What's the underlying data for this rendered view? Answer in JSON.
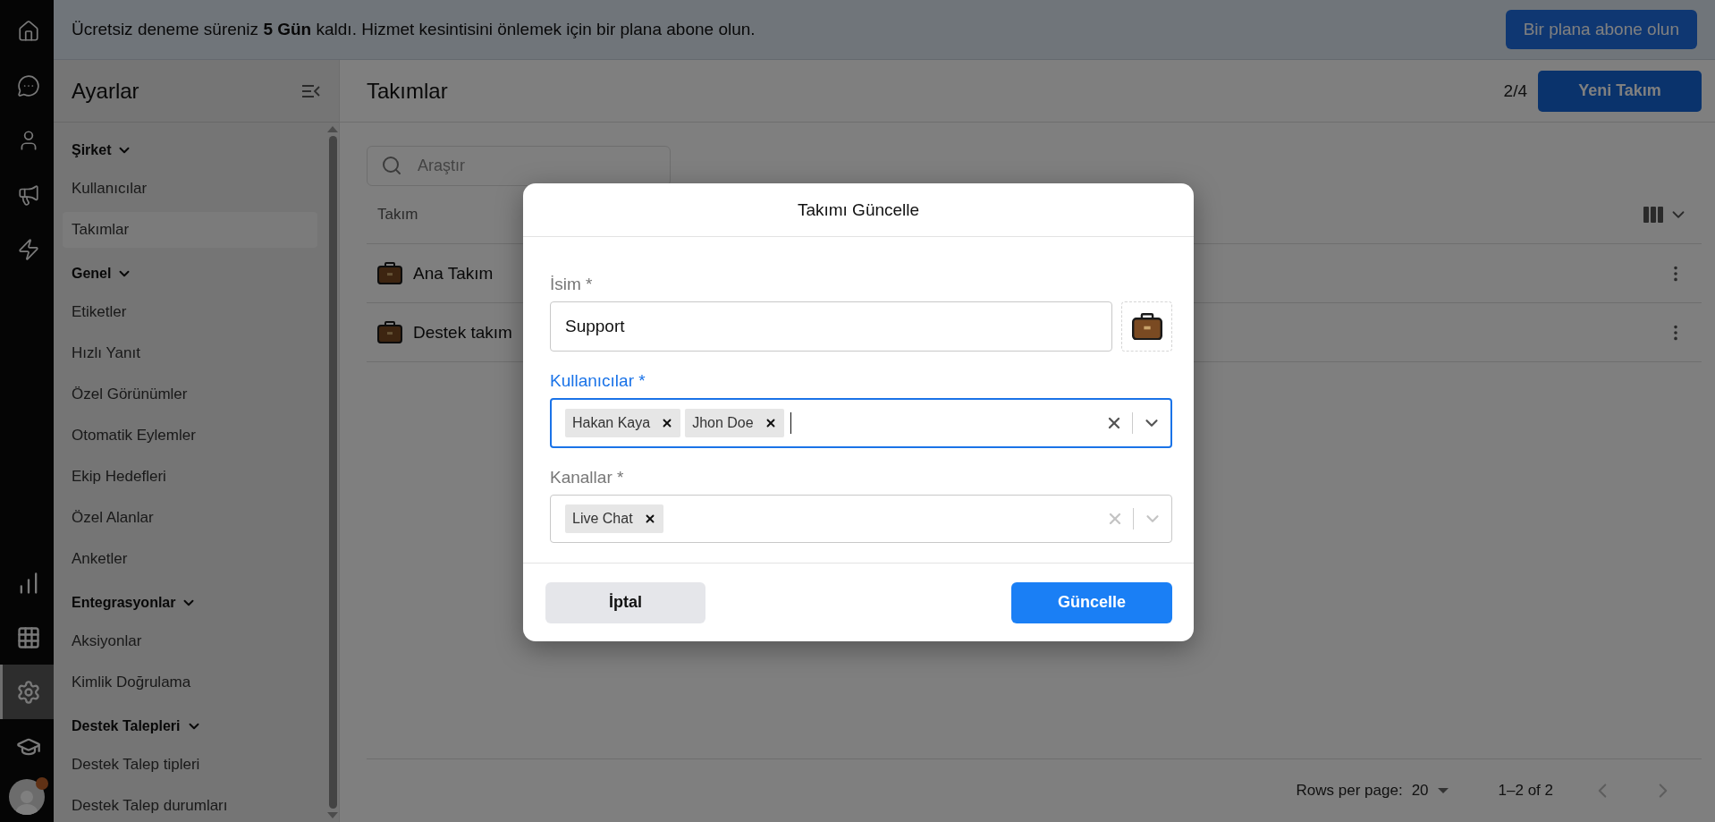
{
  "rail": {
    "top_items": [
      {
        "selected": false
      },
      {
        "selected": false
      },
      {
        "selected": false
      },
      {
        "selected": false
      },
      {
        "selected": false
      }
    ],
    "bottom_items": [
      {
        "selected": false
      },
      {
        "selected": false
      },
      {
        "selected": true
      },
      {
        "selected": false
      }
    ],
    "avatar": {
      "notification": true
    }
  },
  "banner": {
    "text": "Ücretsiz deneme süreniz **5 Gün** kaldı. Hizmet kesintisini önlemek için bir plana abone olun.",
    "button": "Bir plana abone olun"
  },
  "sidebar": {
    "title": "Ayarlar",
    "sections": [
      {
        "title": "Şirket",
        "expanded": true,
        "items": [
          {
            "label": "Kullanıcılar",
            "selected": false
          },
          {
            "label": "Takımlar",
            "selected": true
          }
        ]
      },
      {
        "title": "Genel",
        "expanded": true,
        "items": [
          {
            "label": "Etiketler",
            "selected": false
          },
          {
            "label": "Hızlı Yanıt",
            "selected": false
          },
          {
            "label": "Özel Görünümler",
            "selected": false
          },
          {
            "label": "Otomatik Eylemler",
            "selected": false
          },
          {
            "label": "Ekip Hedefleri",
            "selected": false
          },
          {
            "label": "Özel Alanlar",
            "selected": false
          },
          {
            "label": "Anketler",
            "selected": false
          }
        ]
      },
      {
        "title": "Entegrasyonlar",
        "expanded": true,
        "items": [
          {
            "label": "Aksiyonlar",
            "selected": false
          },
          {
            "label": "Kimlik Doğrulama",
            "selected": false
          }
        ]
      },
      {
        "title": "Destek Talepleri",
        "expanded": true,
        "items": [
          {
            "label": "Destek Talep tipleri",
            "selected": false
          },
          {
            "label": "Destek Talep durumları",
            "selected": false
          }
        ]
      }
    ]
  },
  "main": {
    "title": "Takımlar",
    "count": "2/4",
    "new_button": "Yeni Takım",
    "search": {
      "placeholder": "Araştır"
    },
    "table": {
      "columns": [
        "Takım"
      ],
      "rows": [
        {
          "name": "Ana Takım"
        },
        {
          "name": "Destek takım"
        }
      ]
    },
    "pagination": {
      "rows_per_page_label": "Rows per page:",
      "rows_per_page": "20",
      "range": "1–2 of 2",
      "prev_disabled": true,
      "next_disabled": true
    }
  },
  "modal": {
    "title": "Takımı Güncelle",
    "fields": [
      {
        "kind": "text",
        "label": "İsim *",
        "value": "Support",
        "focused": false
      },
      {
        "kind": "multiselect",
        "label": "Kullanıcılar *",
        "tags": [
          "Hakan Kaya",
          "Jhon Doe"
        ],
        "focused": true
      },
      {
        "kind": "multiselect",
        "label": "Kanallar *",
        "tags": [
          "Live Chat"
        ],
        "focused": false
      }
    ],
    "cancel": "İptal",
    "submit": "Güncelle"
  }
}
